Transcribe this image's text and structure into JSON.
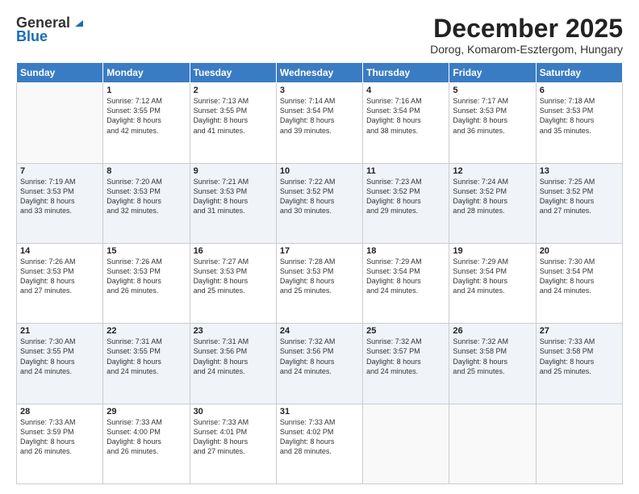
{
  "header": {
    "logo_line1": "General",
    "logo_line2": "Blue",
    "month": "December 2025",
    "location": "Dorog, Komarom-Esztergom, Hungary"
  },
  "days_of_week": [
    "Sunday",
    "Monday",
    "Tuesday",
    "Wednesday",
    "Thursday",
    "Friday",
    "Saturday"
  ],
  "weeks": [
    [
      {
        "day": "",
        "info": ""
      },
      {
        "day": "1",
        "info": "Sunrise: 7:12 AM\nSunset: 3:55 PM\nDaylight: 8 hours\nand 42 minutes."
      },
      {
        "day": "2",
        "info": "Sunrise: 7:13 AM\nSunset: 3:55 PM\nDaylight: 8 hours\nand 41 minutes."
      },
      {
        "day": "3",
        "info": "Sunrise: 7:14 AM\nSunset: 3:54 PM\nDaylight: 8 hours\nand 39 minutes."
      },
      {
        "day": "4",
        "info": "Sunrise: 7:16 AM\nSunset: 3:54 PM\nDaylight: 8 hours\nand 38 minutes."
      },
      {
        "day": "5",
        "info": "Sunrise: 7:17 AM\nSunset: 3:53 PM\nDaylight: 8 hours\nand 36 minutes."
      },
      {
        "day": "6",
        "info": "Sunrise: 7:18 AM\nSunset: 3:53 PM\nDaylight: 8 hours\nand 35 minutes."
      }
    ],
    [
      {
        "day": "7",
        "info": "Sunrise: 7:19 AM\nSunset: 3:53 PM\nDaylight: 8 hours\nand 33 minutes."
      },
      {
        "day": "8",
        "info": "Sunrise: 7:20 AM\nSunset: 3:53 PM\nDaylight: 8 hours\nand 32 minutes."
      },
      {
        "day": "9",
        "info": "Sunrise: 7:21 AM\nSunset: 3:53 PM\nDaylight: 8 hours\nand 31 minutes."
      },
      {
        "day": "10",
        "info": "Sunrise: 7:22 AM\nSunset: 3:52 PM\nDaylight: 8 hours\nand 30 minutes."
      },
      {
        "day": "11",
        "info": "Sunrise: 7:23 AM\nSunset: 3:52 PM\nDaylight: 8 hours\nand 29 minutes."
      },
      {
        "day": "12",
        "info": "Sunrise: 7:24 AM\nSunset: 3:52 PM\nDaylight: 8 hours\nand 28 minutes."
      },
      {
        "day": "13",
        "info": "Sunrise: 7:25 AM\nSunset: 3:52 PM\nDaylight: 8 hours\nand 27 minutes."
      }
    ],
    [
      {
        "day": "14",
        "info": "Sunrise: 7:26 AM\nSunset: 3:53 PM\nDaylight: 8 hours\nand 27 minutes."
      },
      {
        "day": "15",
        "info": "Sunrise: 7:26 AM\nSunset: 3:53 PM\nDaylight: 8 hours\nand 26 minutes."
      },
      {
        "day": "16",
        "info": "Sunrise: 7:27 AM\nSunset: 3:53 PM\nDaylight: 8 hours\nand 25 minutes."
      },
      {
        "day": "17",
        "info": "Sunrise: 7:28 AM\nSunset: 3:53 PM\nDaylight: 8 hours\nand 25 minutes."
      },
      {
        "day": "18",
        "info": "Sunrise: 7:29 AM\nSunset: 3:54 PM\nDaylight: 8 hours\nand 24 minutes."
      },
      {
        "day": "19",
        "info": "Sunrise: 7:29 AM\nSunset: 3:54 PM\nDaylight: 8 hours\nand 24 minutes."
      },
      {
        "day": "20",
        "info": "Sunrise: 7:30 AM\nSunset: 3:54 PM\nDaylight: 8 hours\nand 24 minutes."
      }
    ],
    [
      {
        "day": "21",
        "info": "Sunrise: 7:30 AM\nSunset: 3:55 PM\nDaylight: 8 hours\nand 24 minutes."
      },
      {
        "day": "22",
        "info": "Sunrise: 7:31 AM\nSunset: 3:55 PM\nDaylight: 8 hours\nand 24 minutes."
      },
      {
        "day": "23",
        "info": "Sunrise: 7:31 AM\nSunset: 3:56 PM\nDaylight: 8 hours\nand 24 minutes."
      },
      {
        "day": "24",
        "info": "Sunrise: 7:32 AM\nSunset: 3:56 PM\nDaylight: 8 hours\nand 24 minutes."
      },
      {
        "day": "25",
        "info": "Sunrise: 7:32 AM\nSunset: 3:57 PM\nDaylight: 8 hours\nand 24 minutes."
      },
      {
        "day": "26",
        "info": "Sunrise: 7:32 AM\nSunset: 3:58 PM\nDaylight: 8 hours\nand 25 minutes."
      },
      {
        "day": "27",
        "info": "Sunrise: 7:33 AM\nSunset: 3:58 PM\nDaylight: 8 hours\nand 25 minutes."
      }
    ],
    [
      {
        "day": "28",
        "info": "Sunrise: 7:33 AM\nSunset: 3:59 PM\nDaylight: 8 hours\nand 26 minutes."
      },
      {
        "day": "29",
        "info": "Sunrise: 7:33 AM\nSunset: 4:00 PM\nDaylight: 8 hours\nand 26 minutes."
      },
      {
        "day": "30",
        "info": "Sunrise: 7:33 AM\nSunset: 4:01 PM\nDaylight: 8 hours\nand 27 minutes."
      },
      {
        "day": "31",
        "info": "Sunrise: 7:33 AM\nSunset: 4:02 PM\nDaylight: 8 hours\nand 28 minutes."
      },
      {
        "day": "",
        "info": ""
      },
      {
        "day": "",
        "info": ""
      },
      {
        "day": "",
        "info": ""
      }
    ]
  ]
}
